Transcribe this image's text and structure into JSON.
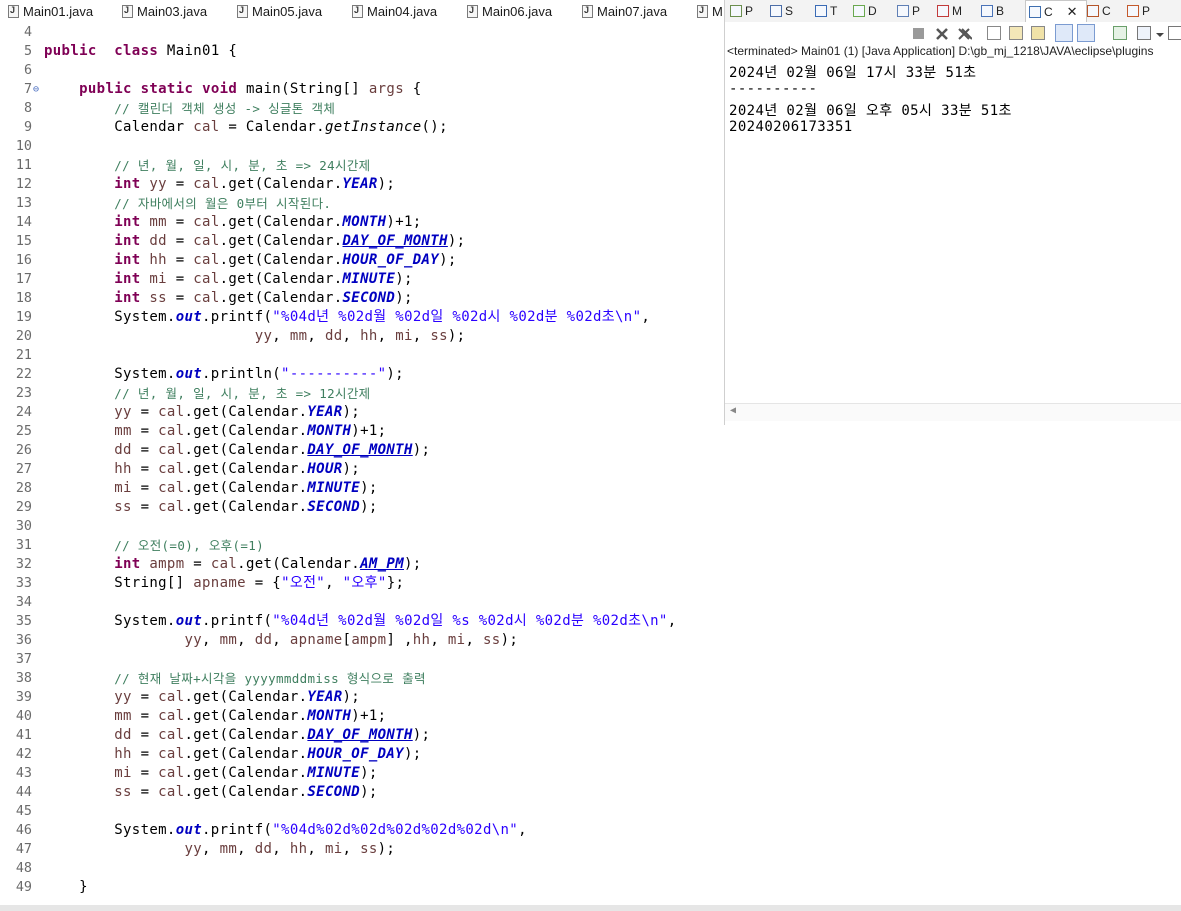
{
  "editor_tabs": [
    "Main01.java",
    "Main03.java",
    "Main05.java",
    "Main04.java",
    "Main06.java",
    "Main07.java",
    "M"
  ],
  "view_tabs": [
    {
      "label": "P",
      "icon": "package-explorer-icon"
    },
    {
      "label": "S",
      "icon": "search-icon"
    },
    {
      "label": "T",
      "icon": "task-icon"
    },
    {
      "label": "D",
      "icon": "declaration-icon"
    },
    {
      "label": "P",
      "icon": "properties-icon"
    },
    {
      "label": "M",
      "icon": "markers-icon"
    },
    {
      "label": "B",
      "icon": "bookmarks-icon"
    },
    {
      "label": "C",
      "icon": "console-icon"
    },
    {
      "label": "C",
      "icon": "coverage-icon"
    },
    {
      "label": "P",
      "icon": "progress-icon"
    }
  ],
  "close_glyph": "✕",
  "console": {
    "header": "<terminated> Main01 (1) [Java Application] D:\\gb_mj_1218\\JAVA\\eclipse\\plugins",
    "lines": [
      "2024년 02월 06일 17시 33분 51초",
      "----------",
      "2024년 02월 06일 오후 05시 33분 51초",
      "20240206173351"
    ]
  },
  "scroll_left_glyph": "◀",
  "code_lines": [
    {
      "n": "4",
      "segs": []
    },
    {
      "n": "5",
      "segs": [
        [
          "kw",
          "public"
        ],
        [
          "",
          "  "
        ],
        [
          "kw",
          "class"
        ],
        [
          "",
          " Main01 {"
        ]
      ]
    },
    {
      "n": "6",
      "segs": []
    },
    {
      "n": "7",
      "fold": true,
      "segs": [
        [
          "",
          "    "
        ],
        [
          "kw",
          "public"
        ],
        [
          "",
          " "
        ],
        [
          "kw",
          "static"
        ],
        [
          "",
          " "
        ],
        [
          "kw",
          "void"
        ],
        [
          "",
          " main(String[] "
        ],
        [
          "var",
          "args"
        ],
        [
          "",
          " {"
        ]
      ]
    },
    {
      "n": "8",
      "segs": [
        [
          "",
          "        "
        ],
        [
          "cm",
          "// 캘린더 객체 생성 -> 싱글톤 객체"
        ]
      ]
    },
    {
      "n": "9",
      "segs": [
        [
          "",
          "        Calendar "
        ],
        [
          "var",
          "cal"
        ],
        [
          "",
          " = Calendar."
        ],
        [
          "sm",
          "getInstance"
        ],
        [
          "",
          "();"
        ]
      ]
    },
    {
      "n": "10",
      "segs": []
    },
    {
      "n": "11",
      "segs": [
        [
          "",
          "        "
        ],
        [
          "cm",
          "// 년, 월, 일, 시, 분, 초 => 24시간제"
        ]
      ]
    },
    {
      "n": "12",
      "segs": [
        [
          "",
          "        "
        ],
        [
          "kw",
          "int"
        ],
        [
          "",
          " "
        ],
        [
          "var",
          "yy"
        ],
        [
          "",
          " = "
        ],
        [
          "var",
          "cal"
        ],
        [
          "",
          ".get(Calendar."
        ],
        [
          "fld",
          "YEAR"
        ],
        [
          "",
          ");"
        ]
      ]
    },
    {
      "n": "13",
      "segs": [
        [
          "",
          "        "
        ],
        [
          "cm",
          "// 자바에서의 월은 0부터 시작된다."
        ]
      ]
    },
    {
      "n": "14",
      "segs": [
        [
          "",
          "        "
        ],
        [
          "kw",
          "int"
        ],
        [
          "",
          " "
        ],
        [
          "var",
          "mm"
        ],
        [
          "",
          " = "
        ],
        [
          "var",
          "cal"
        ],
        [
          "",
          ".get(Calendar."
        ],
        [
          "fld",
          "MONTH"
        ],
        [
          "",
          ")+1;"
        ]
      ]
    },
    {
      "n": "15",
      "segs": [
        [
          "",
          "        "
        ],
        [
          "kw",
          "int"
        ],
        [
          "",
          " "
        ],
        [
          "var",
          "dd"
        ],
        [
          "",
          " = "
        ],
        [
          "var",
          "cal"
        ],
        [
          "",
          ".get(Calendar."
        ],
        [
          "fld",
          "DAY_OF_MONTH"
        ],
        [
          "",
          ");"
        ]
      ]
    },
    {
      "n": "16",
      "segs": [
        [
          "",
          "        "
        ],
        [
          "kw",
          "int"
        ],
        [
          "",
          " "
        ],
        [
          "var",
          "hh"
        ],
        [
          "",
          " = "
        ],
        [
          "var",
          "cal"
        ],
        [
          "",
          ".get(Calendar."
        ],
        [
          "fld",
          "HOUR_OF_DAY"
        ],
        [
          "",
          ");"
        ]
      ]
    },
    {
      "n": "17",
      "segs": [
        [
          "",
          "        "
        ],
        [
          "kw",
          "int"
        ],
        [
          "",
          " "
        ],
        [
          "var",
          "mi"
        ],
        [
          "",
          " = "
        ],
        [
          "var",
          "cal"
        ],
        [
          "",
          ".get(Calendar."
        ],
        [
          "fld",
          "MINUTE"
        ],
        [
          "",
          ");"
        ]
      ]
    },
    {
      "n": "18",
      "segs": [
        [
          "",
          "        "
        ],
        [
          "kw",
          "int"
        ],
        [
          "",
          " "
        ],
        [
          "var",
          "ss"
        ],
        [
          "",
          " = "
        ],
        [
          "var",
          "cal"
        ],
        [
          "",
          ".get(Calendar."
        ],
        [
          "fld",
          "SECOND"
        ],
        [
          "",
          ");"
        ]
      ]
    },
    {
      "n": "19",
      "segs": [
        [
          "",
          "        System."
        ],
        [
          "fld",
          "out"
        ],
        [
          "",
          ".printf("
        ],
        [
          "st",
          "\"%04d년 %02d월 %02d일 %02d시 %02d분 %02d초\\n\""
        ],
        [
          "",
          ","
        ]
      ]
    },
    {
      "n": "20",
      "segs": [
        [
          "",
          "                        "
        ],
        [
          "var",
          "yy"
        ],
        [
          "",
          ", "
        ],
        [
          "var",
          "mm"
        ],
        [
          "",
          ", "
        ],
        [
          "var",
          "dd"
        ],
        [
          "",
          ", "
        ],
        [
          "var",
          "hh"
        ],
        [
          "",
          ", "
        ],
        [
          "var",
          "mi"
        ],
        [
          "",
          ", "
        ],
        [
          "var",
          "ss"
        ],
        [
          "",
          ");"
        ]
      ]
    },
    {
      "n": "21",
      "segs": []
    },
    {
      "n": "22",
      "segs": [
        [
          "",
          "        System."
        ],
        [
          "fld",
          "out"
        ],
        [
          "",
          ".println("
        ],
        [
          "st",
          "\"----------\""
        ],
        [
          "",
          ");"
        ]
      ]
    },
    {
      "n": "23",
      "segs": [
        [
          "",
          "        "
        ],
        [
          "cm",
          "// 년, 월, 일, 시, 분, 초 => 12시간제"
        ]
      ]
    },
    {
      "n": "24",
      "segs": [
        [
          "",
          "        "
        ],
        [
          "var",
          "yy"
        ],
        [
          "",
          " = "
        ],
        [
          "var",
          "cal"
        ],
        [
          "",
          ".get(Calendar."
        ],
        [
          "fld",
          "YEAR"
        ],
        [
          "",
          ");"
        ]
      ]
    },
    {
      "n": "25",
      "segs": [
        [
          "",
          "        "
        ],
        [
          "var",
          "mm"
        ],
        [
          "",
          " = "
        ],
        [
          "var",
          "cal"
        ],
        [
          "",
          ".get(Calendar."
        ],
        [
          "fld",
          "MONTH"
        ],
        [
          "",
          ")+1;"
        ]
      ]
    },
    {
      "n": "26",
      "segs": [
        [
          "",
          "        "
        ],
        [
          "var",
          "dd"
        ],
        [
          "",
          " = "
        ],
        [
          "var",
          "cal"
        ],
        [
          "",
          ".get(Calendar."
        ],
        [
          "fld",
          "DAY_OF_MONTH"
        ],
        [
          "",
          ");"
        ]
      ]
    },
    {
      "n": "27",
      "segs": [
        [
          "",
          "        "
        ],
        [
          "var",
          "hh"
        ],
        [
          "",
          " = "
        ],
        [
          "var",
          "cal"
        ],
        [
          "",
          ".get(Calendar."
        ],
        [
          "fld",
          "HOUR"
        ],
        [
          "",
          ");"
        ]
      ]
    },
    {
      "n": "28",
      "segs": [
        [
          "",
          "        "
        ],
        [
          "var",
          "mi"
        ],
        [
          "",
          " = "
        ],
        [
          "var",
          "cal"
        ],
        [
          "",
          ".get(Calendar."
        ],
        [
          "fld",
          "MINUTE"
        ],
        [
          "",
          ");"
        ]
      ]
    },
    {
      "n": "29",
      "segs": [
        [
          "",
          "        "
        ],
        [
          "var",
          "ss"
        ],
        [
          "",
          " = "
        ],
        [
          "var",
          "cal"
        ],
        [
          "",
          ".get(Calendar."
        ],
        [
          "fld",
          "SECOND"
        ],
        [
          "",
          ");"
        ]
      ]
    },
    {
      "n": "30",
      "segs": []
    },
    {
      "n": "31",
      "segs": [
        [
          "",
          "        "
        ],
        [
          "cm",
          "// 오전(=0), 오후(=1)"
        ]
      ]
    },
    {
      "n": "32",
      "segs": [
        [
          "",
          "        "
        ],
        [
          "kw",
          "int"
        ],
        [
          "",
          " "
        ],
        [
          "var",
          "ampm"
        ],
        [
          "",
          " = "
        ],
        [
          "var",
          "cal"
        ],
        [
          "",
          ".get(Calendar."
        ],
        [
          "fld",
          "AM_PM"
        ],
        [
          "",
          ");"
        ]
      ]
    },
    {
      "n": "33",
      "segs": [
        [
          "",
          "        String[] "
        ],
        [
          "var",
          "apname"
        ],
        [
          "",
          " = {"
        ],
        [
          "st",
          "\"오전\""
        ],
        [
          "",
          ", "
        ],
        [
          "st",
          "\"오후\""
        ],
        [
          "",
          "};"
        ]
      ]
    },
    {
      "n": "34",
      "segs": []
    },
    {
      "n": "35",
      "segs": [
        [
          "",
          "        System."
        ],
        [
          "fld",
          "out"
        ],
        [
          "",
          ".printf("
        ],
        [
          "st",
          "\"%04d년 %02d월 %02d일 %s %02d시 %02d분 %02d초\\n\""
        ],
        [
          "",
          ","
        ]
      ]
    },
    {
      "n": "36",
      "segs": [
        [
          "",
          "                "
        ],
        [
          "var",
          "yy"
        ],
        [
          "",
          ", "
        ],
        [
          "var",
          "mm"
        ],
        [
          "",
          ", "
        ],
        [
          "var",
          "dd"
        ],
        [
          "",
          ", "
        ],
        [
          "var",
          "apname"
        ],
        [
          "",
          "["
        ],
        [
          "var",
          "ampm"
        ],
        [
          "",
          "] ,"
        ],
        [
          "var",
          "hh"
        ],
        [
          "",
          ", "
        ],
        [
          "var",
          "mi"
        ],
        [
          "",
          ", "
        ],
        [
          "var",
          "ss"
        ],
        [
          "",
          ");"
        ]
      ]
    },
    {
      "n": "37",
      "segs": []
    },
    {
      "n": "38",
      "segs": [
        [
          "",
          "        "
        ],
        [
          "cm",
          "// 현재 날짜+시각을 yyyymmddmiss 형식으로 출력"
        ]
      ]
    },
    {
      "n": "39",
      "segs": [
        [
          "",
          "        "
        ],
        [
          "var",
          "yy"
        ],
        [
          "",
          " = "
        ],
        [
          "var",
          "cal"
        ],
        [
          "",
          ".get(Calendar."
        ],
        [
          "fld",
          "YEAR"
        ],
        [
          "",
          ");"
        ]
      ]
    },
    {
      "n": "40",
      "segs": [
        [
          "",
          "        "
        ],
        [
          "var",
          "mm"
        ],
        [
          "",
          " = "
        ],
        [
          "var",
          "cal"
        ],
        [
          "",
          ".get(Calendar."
        ],
        [
          "fld",
          "MONTH"
        ],
        [
          "",
          ")+1;"
        ]
      ]
    },
    {
      "n": "41",
      "segs": [
        [
          "",
          "        "
        ],
        [
          "var",
          "dd"
        ],
        [
          "",
          " = "
        ],
        [
          "var",
          "cal"
        ],
        [
          "",
          ".get(Calendar."
        ],
        [
          "fld",
          "DAY_OF_MONTH"
        ],
        [
          "",
          ");"
        ]
      ]
    },
    {
      "n": "42",
      "segs": [
        [
          "",
          "        "
        ],
        [
          "var",
          "hh"
        ],
        [
          "",
          " = "
        ],
        [
          "var",
          "cal"
        ],
        [
          "",
          ".get(Calendar."
        ],
        [
          "fld",
          "HOUR_OF_DAY"
        ],
        [
          "",
          ");"
        ]
      ]
    },
    {
      "n": "43",
      "segs": [
        [
          "",
          "        "
        ],
        [
          "var",
          "mi"
        ],
        [
          "",
          " = "
        ],
        [
          "var",
          "cal"
        ],
        [
          "",
          ".get(Calendar."
        ],
        [
          "fld",
          "MINUTE"
        ],
        [
          "",
          ");"
        ]
      ]
    },
    {
      "n": "44",
      "segs": [
        [
          "",
          "        "
        ],
        [
          "var",
          "ss"
        ],
        [
          "",
          " = "
        ],
        [
          "var",
          "cal"
        ],
        [
          "",
          ".get(Calendar."
        ],
        [
          "fld",
          "SECOND"
        ],
        [
          "",
          ");"
        ]
      ]
    },
    {
      "n": "45",
      "segs": []
    },
    {
      "n": "46",
      "segs": [
        [
          "",
          "        System."
        ],
        [
          "fld",
          "out"
        ],
        [
          "",
          ".printf("
        ],
        [
          "st",
          "\"%04d%02d%02d%02d%02d%02d\\n\""
        ],
        [
          "",
          ","
        ]
      ]
    },
    {
      "n": "47",
      "segs": [
        [
          "",
          "                "
        ],
        [
          "var",
          "yy"
        ],
        [
          "",
          ", "
        ],
        [
          "var",
          "mm"
        ],
        [
          "",
          ", "
        ],
        [
          "var",
          "dd"
        ],
        [
          "",
          ", "
        ],
        [
          "var",
          "hh"
        ],
        [
          "",
          ", "
        ],
        [
          "var",
          "mi"
        ],
        [
          "",
          ", "
        ],
        [
          "var",
          "ss"
        ],
        [
          "",
          ");"
        ]
      ]
    },
    {
      "n": "48",
      "segs": []
    },
    {
      "n": "49",
      "segs": [
        [
          "",
          "    }"
        ]
      ]
    }
  ]
}
